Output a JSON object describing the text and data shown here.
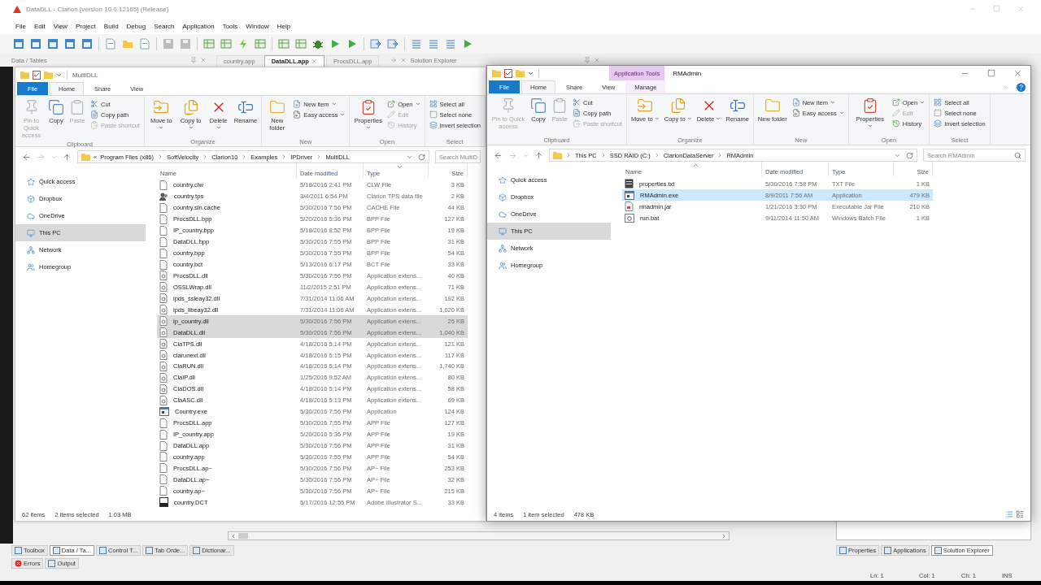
{
  "ide": {
    "title": "DataDLL - Clarion [version 10.0.12165] (Release)",
    "menu": [
      "File",
      "Edit",
      "View",
      "Project",
      "Build",
      "Debug",
      "Search",
      "Application",
      "Tools",
      "Window",
      "Help"
    ],
    "left_pane": {
      "title": "Data / Tables"
    },
    "doc_tabs": [
      {
        "label": "country.app",
        "selected": false
      },
      {
        "label": "DataDLL.app",
        "selected": true
      },
      {
        "label": "ProcsDLL.app",
        "selected": false
      }
    ],
    "right_pane": {
      "title": "Solution Explorer"
    },
    "bottom_tabs": [
      {
        "label": "Toolbox",
        "selected": false
      },
      {
        "label": "Data / Ta...",
        "selected": true
      },
      {
        "label": "Control T...",
        "selected": false
      },
      {
        "label": "Tab Orde...",
        "selected": false
      },
      {
        "label": "Dictionar...",
        "selected": false
      }
    ],
    "output_tabs": [
      "Errors",
      "Output"
    ],
    "right_tabs": [
      {
        "label": "Properties",
        "selected": false
      },
      {
        "label": "Applications",
        "selected": false
      },
      {
        "label": "Solution Explorer",
        "selected": true
      }
    ],
    "status": [
      "Ln: 1",
      "Col: 1",
      "Ch: 1",
      "INS"
    ]
  },
  "windows": [
    {
      "title": "MultiDLL",
      "active": false,
      "show_controls": false,
      "ribbon_tabs": [
        {
          "label": "File",
          "kind": "file",
          "selected": false
        },
        {
          "label": "Home",
          "kind": "normal",
          "selected": true
        },
        {
          "label": "Share",
          "kind": "normal",
          "selected": false
        },
        {
          "label": "View",
          "kind": "normal",
          "selected": false
        }
      ],
      "ribbon": [
        {
          "label": "Clipboard",
          "buttons": [
            {
              "label": "Pin to Quick access",
              "kind": "large",
              "disabled": true,
              "dropdown": false
            },
            {
              "label": "Copy",
              "kind": "large",
              "disabled": false,
              "dropdown": false
            },
            {
              "label": "Paste",
              "kind": "large",
              "disabled": true,
              "dropdown": false
            },
            {
              "label": "Cut",
              "kind": "small",
              "disabled": false,
              "dropdown": false
            },
            {
              "label": "Copy path",
              "kind": "small",
              "disabled": false,
              "dropdown": false
            },
            {
              "label": "Paste shortcut",
              "kind": "small",
              "disabled": true,
              "dropdown": false
            }
          ]
        },
        {
          "label": "Organize",
          "buttons": [
            {
              "label": "Move to",
              "kind": "large",
              "disabled": false,
              "dropdown": true
            },
            {
              "label": "Copy to",
              "kind": "large",
              "disabled": false,
              "dropdown": true
            },
            {
              "label": "Delete",
              "kind": "large",
              "disabled": false,
              "dropdown": true
            },
            {
              "label": "Rename",
              "kind": "large",
              "disabled": false,
              "dropdown": false
            }
          ]
        },
        {
          "label": "New",
          "buttons": [
            {
              "label": "New folder",
              "kind": "large",
              "disabled": false,
              "dropdown": false
            },
            {
              "label": "New item",
              "kind": "small",
              "disabled": false,
              "dropdown": true
            },
            {
              "label": "Easy access",
              "kind": "small",
              "disabled": false,
              "dropdown": true
            }
          ]
        },
        {
          "label": "Open",
          "buttons": [
            {
              "label": "Properties",
              "kind": "large",
              "disabled": false,
              "dropdown": true
            },
            {
              "label": "Open",
              "kind": "small",
              "disabled": false,
              "dropdown": true
            },
            {
              "label": "Edit",
              "kind": "small",
              "disabled": true,
              "dropdown": false
            },
            {
              "label": "History",
              "kind": "small",
              "disabled": true,
              "dropdown": false
            }
          ]
        },
        {
          "label": "Select",
          "buttons": [
            {
              "label": "Select all",
              "kind": "small",
              "disabled": false,
              "dropdown": false
            },
            {
              "label": "Select none",
              "kind": "small",
              "disabled": false,
              "dropdown": false
            },
            {
              "label": "Invert selection",
              "kind": "small",
              "disabled": false,
              "dropdown": false
            }
          ]
        }
      ],
      "address": {
        "overflow_mark": "«",
        "crumbs": [
          "Program Files (x86)",
          "SoftVelocity",
          "Clarion10",
          "Examples",
          "IPDriver",
          "MultiDLL"
        ]
      },
      "search": {
        "placeholder": "Search MultiD"
      },
      "nav": [
        {
          "label": "Quick access",
          "selected": false
        },
        {
          "label": "Dropbox",
          "selected": false
        },
        {
          "label": "OneDrive",
          "selected": false
        },
        {
          "label": "This PC",
          "selected": true
        },
        {
          "label": "Network",
          "selected": false
        },
        {
          "label": "Homegroup",
          "selected": false
        }
      ],
      "columns": [
        {
          "label": "Name",
          "sorted": false
        },
        {
          "label": "Date modified",
          "sorted": false
        },
        {
          "label": "Type",
          "sorted": true,
          "ascending": false
        },
        {
          "label": "Size",
          "sorted": false
        }
      ],
      "rows": [
        {
          "name": "country.clw",
          "kind": "plain",
          "date": "5/18/2016 2:41 PM",
          "type": "CLW File",
          "size": "3 KB",
          "selected": false
        },
        {
          "name": "country.tps",
          "kind": "database",
          "date": "3/4/2011 6:54 PM",
          "type": "Clarion TPS data file",
          "size": "2 KB",
          "selected": false
        },
        {
          "name": "country.sln.cache",
          "kind": "plain",
          "date": "5/30/2016 7:56 PM",
          "type": "CACHE File",
          "size": "44 KB",
          "selected": false
        },
        {
          "name": "ProcsDLL.bpp",
          "kind": "plain",
          "date": "5/20/2016 5:36 PM",
          "type": "BPP File",
          "size": "127 KB",
          "selected": false
        },
        {
          "name": "IP_country.bpp",
          "kind": "plain",
          "date": "5/18/2016 8:52 PM",
          "type": "BPP File",
          "size": "19 KB",
          "selected": false
        },
        {
          "name": "DataDLL.bpp",
          "kind": "plain",
          "date": "5/30/2016 7:55 PM",
          "type": "BPP File",
          "size": "31 KB",
          "selected": false
        },
        {
          "name": "country.bpp",
          "kind": "plain",
          "date": "5/30/2016 7:55 PM",
          "type": "BPP File",
          "size": "54 KB",
          "selected": false
        },
        {
          "name": "country.bct",
          "kind": "plain",
          "date": "5/13/2016 6:17 PM",
          "type": "BCT File",
          "size": "33 KB",
          "selected": false
        },
        {
          "name": "ProcsDLL.dll",
          "kind": "library",
          "date": "5/30/2016 7:56 PM",
          "type": "Application extens...",
          "size": "40 KB",
          "selected": false
        },
        {
          "name": "OSSLWrap.dll",
          "kind": "library",
          "date": "11/2/2015 2:51 PM",
          "type": "Application extens...",
          "size": "71 KB",
          "selected": false
        },
        {
          "name": "ipds_ssleay32.dll",
          "kind": "library",
          "date": "7/31/2014 11:06 AM",
          "type": "Application extens...",
          "size": "192 KB",
          "selected": false
        },
        {
          "name": "ipds_libeay32.dll",
          "kind": "library",
          "date": "7/31/2014 11:06 AM",
          "type": "Application extens...",
          "size": "1,020 KB",
          "selected": false
        },
        {
          "name": "ip_country.dll",
          "kind": "library",
          "date": "5/30/2016 7:56 PM",
          "type": "Application extens...",
          "size": "25 KB",
          "selected": true
        },
        {
          "name": "DataDLL.dll",
          "kind": "library",
          "date": "5/30/2016 7:56 PM",
          "type": "Application extens...",
          "size": "1,040 KB",
          "selected": true
        },
        {
          "name": "ClaTPS.dll",
          "kind": "library",
          "date": "4/18/2016 5:14 PM",
          "type": "Application extens...",
          "size": "121 KB",
          "selected": false
        },
        {
          "name": "clarunext.dll",
          "kind": "library",
          "date": "4/18/2016 5:15 PM",
          "type": "Application extens...",
          "size": "117 KB",
          "selected": false
        },
        {
          "name": "ClaRUN.dll",
          "kind": "library",
          "date": "4/18/2016 5:14 PM",
          "type": "Application extens...",
          "size": "1,740 KB",
          "selected": false
        },
        {
          "name": "ClaIP.dll",
          "kind": "library",
          "date": "1/25/2016 9:52 AM",
          "type": "Application extens...",
          "size": "80 KB",
          "selected": false
        },
        {
          "name": "ClaDOS.dll",
          "kind": "library",
          "date": "4/18/2016 5:14 PM",
          "type": "Application extens...",
          "size": "58 KB",
          "selected": false
        },
        {
          "name": "ClaASC.dll",
          "kind": "library",
          "date": "4/18/2016 5:13 PM",
          "type": "Application extens...",
          "size": "69 KB",
          "selected": false
        },
        {
          "name": "Country.exe",
          "kind": "program",
          "date": "5/30/2016 7:56 PM",
          "type": "Application",
          "size": "124 KB",
          "selected": false
        },
        {
          "name": "ProcsDLL.app",
          "kind": "plain",
          "date": "5/30/2016 7:55 PM",
          "type": "APP File",
          "size": "127 KB",
          "selected": false
        },
        {
          "name": "IP_country.app",
          "kind": "plain",
          "date": "5/20/2016 5:36 PM",
          "type": "APP File",
          "size": "19 KB",
          "selected": false
        },
        {
          "name": "DataDLL.app",
          "kind": "plain",
          "date": "5/30/2016 7:56 PM",
          "type": "APP File",
          "size": "31 KB",
          "selected": false
        },
        {
          "name": "country.app",
          "kind": "plain",
          "date": "5/30/2016 7:55 PM",
          "type": "APP File",
          "size": "54 KB",
          "selected": false
        },
        {
          "name": "ProcsDLL.ap~",
          "kind": "plain",
          "date": "5/30/2016 7:56 PM",
          "type": "AP~ File",
          "size": "253 KB",
          "selected": false
        },
        {
          "name": "DataDLL.ap~",
          "kind": "plain",
          "date": "5/30/2016 7:56 PM",
          "type": "AP~ File",
          "size": "32 KB",
          "selected": false
        },
        {
          "name": "country.ap~",
          "kind": "plain",
          "date": "5/30/2016 7:56 PM",
          "type": "AP~ File",
          "size": "215 KB",
          "selected": false
        },
        {
          "name": "country.DCT",
          "kind": "graphic",
          "date": "5/17/2016 12:55 PM",
          "type": "Adobe Illustrator S...",
          "size": "33 KB",
          "selected": false
        }
      ],
      "status": {
        "count": "62 items",
        "selection": "2 items selected",
        "size": "1.03 MB"
      }
    },
    {
      "title": "RMAdmin",
      "active": true,
      "show_controls": true,
      "ribbon_tabs": [
        {
          "label": "File",
          "kind": "file",
          "selected": false
        },
        {
          "label": "Home",
          "kind": "normal",
          "selected": true
        },
        {
          "label": "Share",
          "kind": "normal",
          "selected": false
        },
        {
          "label": "View",
          "kind": "normal",
          "selected": false
        },
        {
          "label": "Manage",
          "kind": "contextual",
          "group": "Application Tools",
          "selected": false
        }
      ],
      "ribbon": [
        {
          "label": "Clipboard",
          "buttons": [
            {
              "label": "Pin to Quick access",
              "kind": "large",
              "disabled": true,
              "dropdown": false
            },
            {
              "label": "Copy",
              "kind": "large",
              "disabled": false,
              "dropdown": false
            },
            {
              "label": "Paste",
              "kind": "large",
              "disabled": true,
              "dropdown": false
            },
            {
              "label": "Cut",
              "kind": "small",
              "disabled": false,
              "dropdown": false
            },
            {
              "label": "Copy path",
              "kind": "small",
              "disabled": false,
              "dropdown": false
            },
            {
              "label": "Paste shortcut",
              "kind": "small",
              "disabled": true,
              "dropdown": false
            }
          ]
        },
        {
          "label": "Organize",
          "buttons": [
            {
              "label": "Move to",
              "kind": "large",
              "disabled": false,
              "dropdown": true
            },
            {
              "label": "Copy to",
              "kind": "large",
              "disabled": false,
              "dropdown": true
            },
            {
              "label": "Delete",
              "kind": "large",
              "disabled": false,
              "dropdown": true
            },
            {
              "label": "Rename",
              "kind": "large",
              "disabled": false,
              "dropdown": false
            }
          ]
        },
        {
          "label": "New",
          "buttons": [
            {
              "label": "New folder",
              "kind": "large",
              "disabled": false,
              "dropdown": false
            },
            {
              "label": "New item",
              "kind": "small",
              "disabled": false,
              "dropdown": true
            },
            {
              "label": "Easy access",
              "kind": "small",
              "disabled": false,
              "dropdown": true
            }
          ]
        },
        {
          "label": "Open",
          "buttons": [
            {
              "label": "Properties",
              "kind": "large",
              "disabled": false,
              "dropdown": true
            },
            {
              "label": "Open",
              "kind": "small",
              "disabled": false,
              "dropdown": true
            },
            {
              "label": "Edit",
              "kind": "small",
              "disabled": true,
              "dropdown": false
            },
            {
              "label": "History",
              "kind": "small",
              "disabled": false,
              "dropdown": false
            }
          ]
        },
        {
          "label": "Select",
          "buttons": [
            {
              "label": "Select all",
              "kind": "small",
              "disabled": false,
              "dropdown": false
            },
            {
              "label": "Select none",
              "kind": "small",
              "disabled": false,
              "dropdown": false
            },
            {
              "label": "Invert selection",
              "kind": "small",
              "disabled": false,
              "dropdown": false
            }
          ]
        }
      ],
      "address": {
        "crumbs": [
          "This PC",
          "SSD RAID (C:)",
          "ClarionDataServer",
          "RMAdmin"
        ]
      },
      "search": {
        "placeholder": "Search RMAdmin"
      },
      "nav": [
        {
          "label": "Quick access",
          "selected": false
        },
        {
          "label": "Dropbox",
          "selected": false
        },
        {
          "label": "OneDrive",
          "selected": false
        },
        {
          "label": "This PC",
          "selected": true
        },
        {
          "label": "Network",
          "selected": false
        },
        {
          "label": "Homegroup",
          "selected": false
        }
      ],
      "columns": [
        {
          "label": "Name",
          "sorted": true,
          "ascending": true
        },
        {
          "label": "Date modified",
          "sorted": false
        },
        {
          "label": "Type",
          "sorted": false
        },
        {
          "label": "Size",
          "sorted": false
        }
      ],
      "rows": [
        {
          "name": "properties.txt",
          "kind": "text",
          "date": "5/30/2016 7:58 PM",
          "type": "TXT File",
          "size": "1 KB",
          "selected": false
        },
        {
          "name": "RMAdmin.exe",
          "kind": "program",
          "date": "8/9/2011 7:56 AM",
          "type": "Application",
          "size": "479 KB",
          "selected": true
        },
        {
          "name": "rmadmin.jar",
          "kind": "archive",
          "date": "1/21/2016 3:30 PM",
          "type": "Executable Jar File",
          "size": "210 KB",
          "selected": false
        },
        {
          "name": "run.bat",
          "kind": "script",
          "date": "9/11/2014 11:50 AM",
          "type": "Windows Batch File",
          "size": "1 KB",
          "selected": false
        }
      ],
      "status": {
        "count": "4 items",
        "selection": "1 item selected",
        "size": "478 KB"
      }
    }
  ]
}
